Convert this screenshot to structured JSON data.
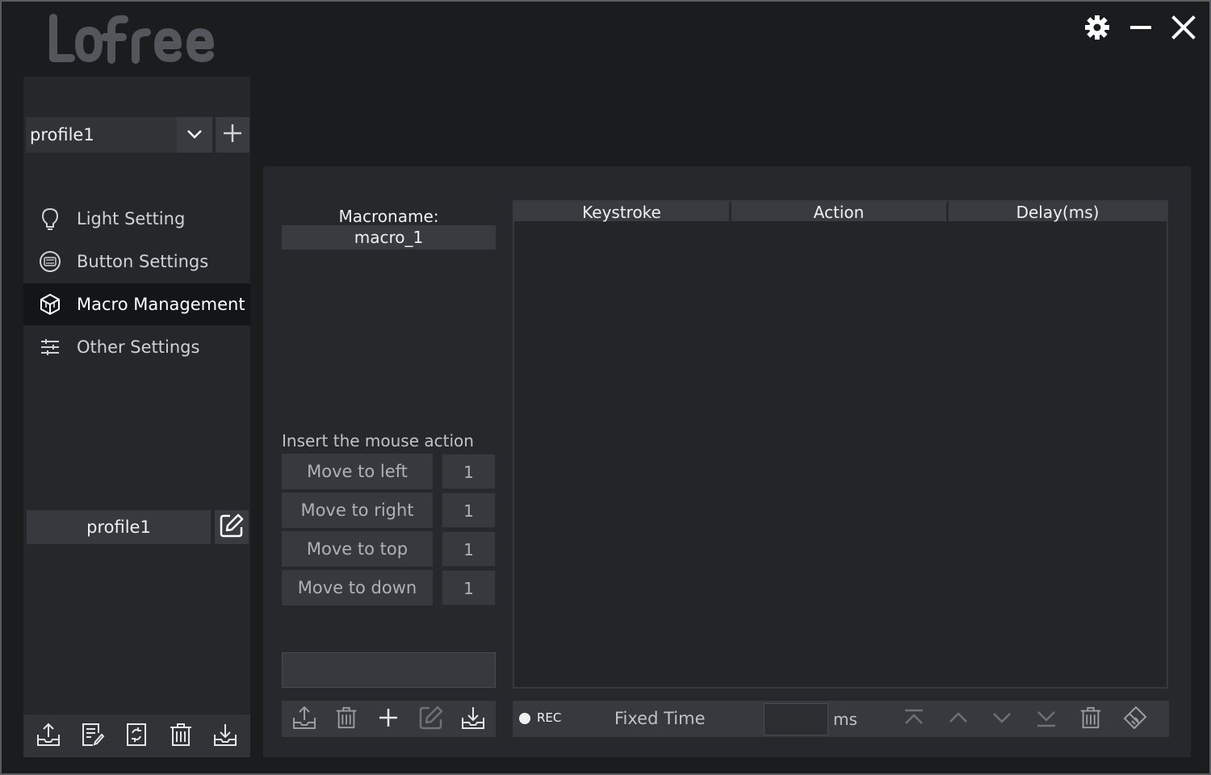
{
  "brand": {
    "logo_text": "Lofree"
  },
  "titlebar": {
    "settings_icon": "gear-icon",
    "minimize_icon": "minimize-icon",
    "close_icon": "close-icon"
  },
  "sidebar": {
    "profile_select": {
      "value": "profile1"
    },
    "nav": [
      {
        "label": "Light Setting",
        "icon": "bulb-icon",
        "active": false
      },
      {
        "label": "Button Settings",
        "icon": "keyboard-keys-icon",
        "active": false
      },
      {
        "label": "Macro Management",
        "icon": "cube-icon",
        "active": true
      },
      {
        "label": "Other Settings",
        "icon": "sliders-icon",
        "active": false
      }
    ],
    "profile_name": "profile1"
  },
  "macro": {
    "name_label": "Macroname:",
    "name_value": "macro_1",
    "insert_label": "Insert the mouse action",
    "mouse_actions": [
      {
        "label": "Move to left",
        "value": "1"
      },
      {
        "label": "Move to right",
        "value": "1"
      },
      {
        "label": "Move to top",
        "value": "1"
      },
      {
        "label": "Move to down",
        "value": "1"
      }
    ]
  },
  "table": {
    "columns": [
      "Keystroke",
      "Action",
      "Delay(ms)"
    ],
    "rows": []
  },
  "recorder": {
    "rec_label": "REC",
    "fixed_time_label": "Fixed Time",
    "ms_value": "",
    "ms_label": "ms"
  },
  "colors": {
    "background": "#1b1c1e",
    "panel": "#27282c",
    "sidebar": "#26272b",
    "control": "#38393e",
    "active_nav": "#141517",
    "text": "#f0f0f0"
  }
}
